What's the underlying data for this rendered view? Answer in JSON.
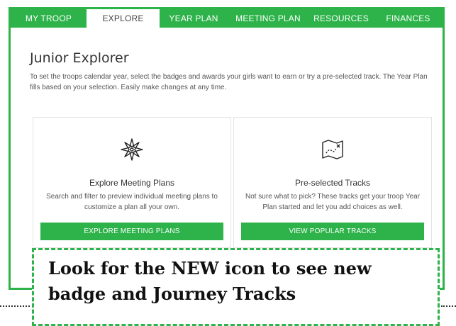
{
  "nav": {
    "tabs": [
      {
        "label": "MY TROOP",
        "active": false
      },
      {
        "label": "EXPLORE",
        "active": true
      },
      {
        "label": "YEAR PLAN",
        "active": false
      },
      {
        "label": "MEETING PLAN",
        "active": false
      },
      {
        "label": "RESOURCES",
        "active": false
      },
      {
        "label": "FINANCES",
        "active": false
      }
    ]
  },
  "page": {
    "title": "Junior Explorer",
    "description": "To set the troops calendar year, select the badges and awards your girls want to earn or try a pre-selected track. The Year Plan fills based on your selection. Easily make changes at any time."
  },
  "cards": [
    {
      "icon": "compass-star-icon",
      "title": "Explore Meeting Plans",
      "description": "Search and filter to preview individual meeting plans to customize a plan all your own.",
      "button": "EXPLORE MEETING PLANS"
    },
    {
      "icon": "treasure-map-icon",
      "title": "Pre-selected Tracks",
      "description": "Not sure what to pick? These tracks get your troop Year Plan started and let you add choices as well.",
      "button": "VIEW POPULAR TRACKS"
    }
  ],
  "callout": {
    "text": "Look for the NEW icon to see new badge and Journey Tracks"
  },
  "colors": {
    "brand_green": "#2db34a",
    "callout_border": "#2db34a"
  }
}
